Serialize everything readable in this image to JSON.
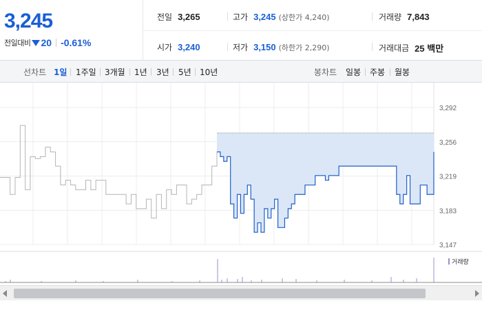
{
  "quote": {
    "price": "3,245",
    "diff_label": "전일대비",
    "diff_value": "20",
    "diff_direction": "down",
    "diff_rate": "-0.61%",
    "stats": {
      "prev_close": {
        "label": "전일",
        "value": "3,265"
      },
      "high": {
        "label": "고가",
        "value": "3,245",
        "sub": "(상한가 4,240)"
      },
      "volume": {
        "label": "거래량",
        "value": "7,843"
      },
      "open": {
        "label": "시가",
        "value": "3,240"
      },
      "low": {
        "label": "저가",
        "value": "3,150",
        "sub": "(하한가 2,290)"
      },
      "amount": {
        "label": "거래대금",
        "value": "25 백만"
      }
    }
  },
  "tabs": {
    "line_label": "선차트",
    "line_items": [
      "1일",
      "1주일",
      "3개월",
      "1년",
      "3년",
      "5년",
      "10년"
    ],
    "line_active": "1일",
    "candle_label": "봉차트",
    "candle_items": [
      "일봉",
      "주봉",
      "월봉"
    ]
  },
  "colors": {
    "accent": "#1a5fd4",
    "line_today": "#1f5fc9",
    "line_prev": "#b4b4b4",
    "area_fill": "#dbe7f7",
    "volume_bar": "#9a8fc9"
  },
  "chart_data": {
    "type": "line",
    "y_ticks": [
      "3,292",
      "3,256",
      "3,219",
      "3,183",
      "3,147"
    ],
    "ylim": [
      3147,
      3292
    ],
    "prev_close_reference": 3265,
    "volume_legend": "거래량",
    "series": [
      {
        "values": [
          3218,
          3218,
          3200,
          3218,
          3273,
          3205,
          3240,
          3238,
          3240,
          3250,
          3245,
          3230,
          3210,
          3215,
          3210,
          3205,
          3205,
          3215,
          3205,
          3215,
          3215,
          3200,
          3200,
          3200,
          3200,
          3190,
          3200,
          3185,
          3185,
          3195,
          3175,
          3200,
          3185,
          3205,
          3200,
          3210,
          3210,
          3190,
          3195,
          3200,
          3210,
          3210,
          3230,
          3245
        ]
      },
      {
        "values": [
          3245,
          3240,
          3235,
          3240,
          3190,
          3175,
          3200,
          3180,
          3200,
          3210,
          3195,
          3160,
          3170,
          3160,
          3185,
          3175,
          3185,
          3195,
          3165,
          3165,
          3175,
          3185,
          3190,
          3200,
          3200,
          3200,
          3210,
          3210,
          3210,
          3220,
          3220,
          3220,
          3215,
          3220,
          3220,
          3220,
          3230,
          3230,
          3230,
          3230,
          3230,
          3230,
          3230,
          3230,
          3230,
          3230,
          3230,
          3230,
          3230,
          3230,
          3230,
          3230,
          3230,
          3200,
          3190,
          3200,
          3220,
          3190,
          3190,
          3190,
          3210,
          3210,
          3200,
          3200,
          3245
        ]
      }
    ]
  }
}
